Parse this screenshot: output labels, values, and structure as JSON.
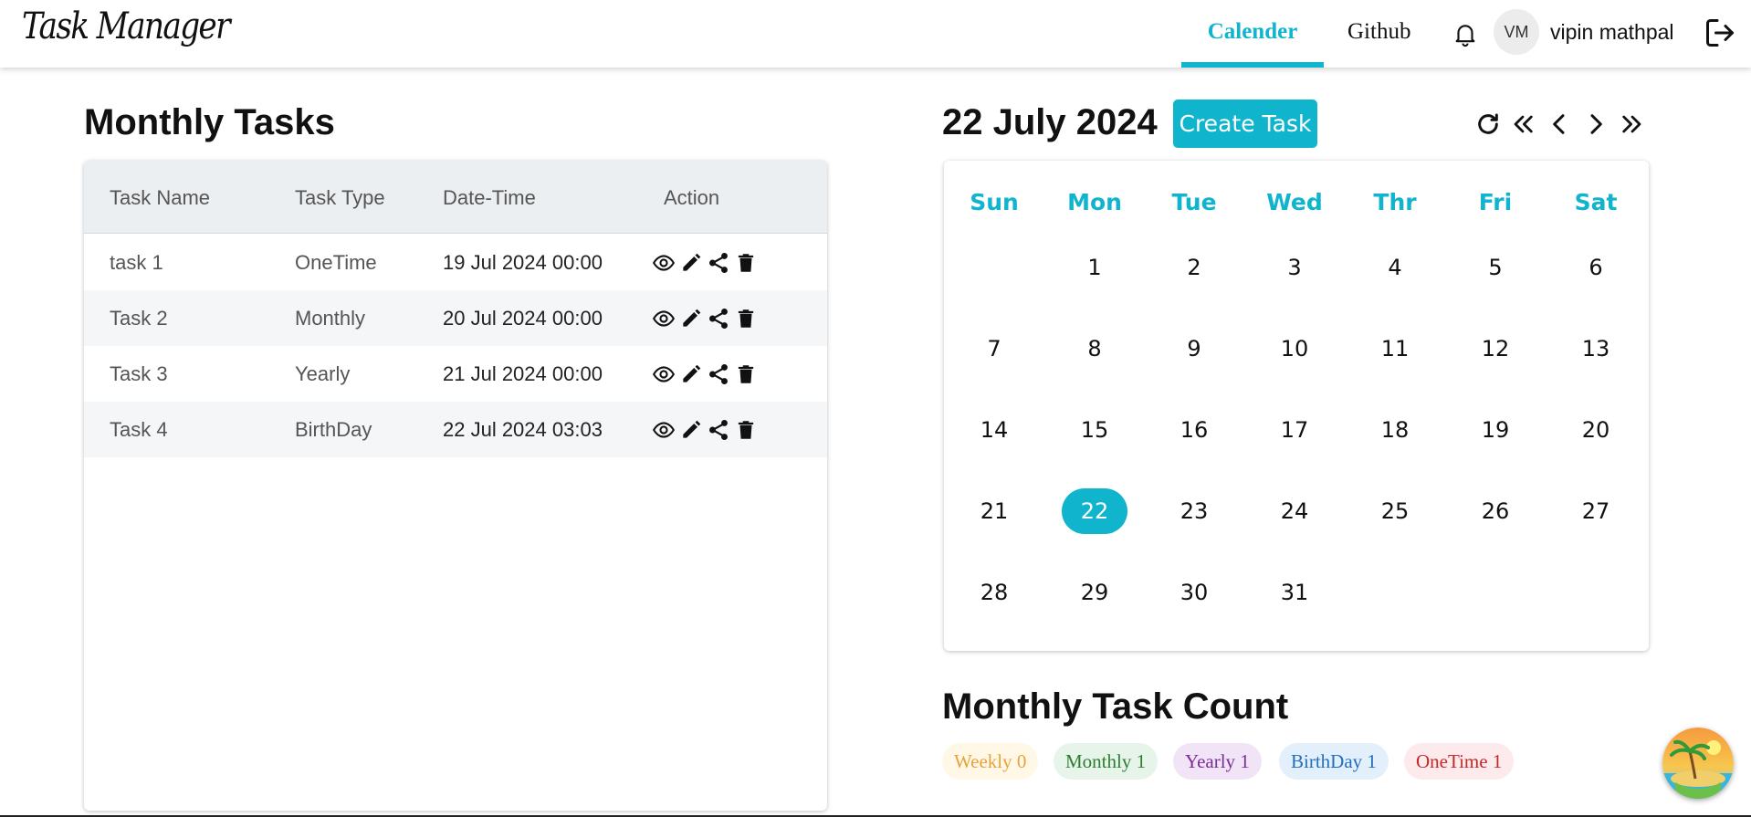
{
  "header": {
    "logo": "Task Manager",
    "nav": [
      {
        "label": "Calender",
        "active": true
      },
      {
        "label": "Github",
        "active": false
      }
    ],
    "user_initials": "VM",
    "user_name": "vipin mathpal"
  },
  "tasks_panel": {
    "title": "Monthly Tasks",
    "columns": [
      "Task Name",
      "Task Type",
      "Date-Time",
      "Action"
    ],
    "rows": [
      {
        "name": "task 1",
        "type": "OneTime",
        "datetime": "19 Jul 2024 00:00"
      },
      {
        "name": "Task 2",
        "type": "Monthly",
        "datetime": "20 Jul 2024 00:00"
      },
      {
        "name": "Task 3",
        "type": "Yearly",
        "datetime": "21 Jul 2024 00:00"
      },
      {
        "name": "Task 4",
        "type": "BirthDay",
        "datetime": "22 Jul 2024 03:03"
      }
    ],
    "action_icons": [
      "view-icon",
      "edit-icon",
      "share-icon",
      "delete-icon"
    ]
  },
  "calendar": {
    "title": "22 July 2024",
    "create_label": "Create Task",
    "nav_icons": [
      "refresh-icon",
      "double-chevron-left-icon",
      "chevron-left-icon",
      "chevron-right-icon",
      "double-chevron-right-icon"
    ],
    "weekdays": [
      "Sun",
      "Mon",
      "Tue",
      "Wed",
      "Thr",
      "Fri",
      "Sat"
    ],
    "first_weekday_index": 1,
    "days_in_month": 31,
    "selected_day": 22
  },
  "task_count": {
    "title": "Monthly Task Count",
    "items": [
      {
        "label": "Weekly",
        "count": "0"
      },
      {
        "label": "Monthly",
        "count": "1"
      },
      {
        "label": "Yearly",
        "count": "1"
      },
      {
        "label": "BirthDay",
        "count": "1"
      },
      {
        "label": "OneTime",
        "count": "1"
      }
    ]
  },
  "colors": {
    "accent": "#10b5cd",
    "weekly": "#e8a33b",
    "monthly": "#2e7d32",
    "yearly": "#7b2d96",
    "birthday": "#1f6fbf",
    "onetime": "#c62828"
  }
}
